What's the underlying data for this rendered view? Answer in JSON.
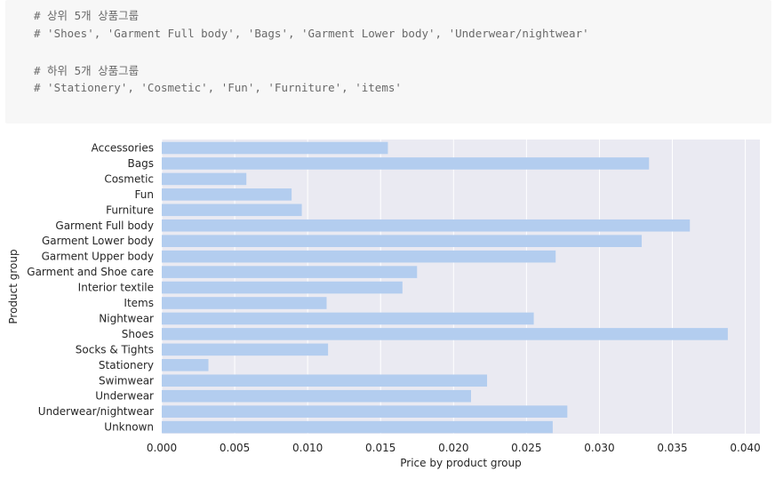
{
  "code_cell": {
    "lines": [
      "# 상위 5개 상품그룹",
      "# 'Shoes', 'Garment Full body', 'Bags', 'Garment Lower body', 'Underwear/nightwear'",
      "",
      "# 하위 5개 상품그룹",
      "# 'Stationery', 'Cosmetic', 'Fun', 'Furniture', 'items'"
    ]
  },
  "chart_data": {
    "type": "bar",
    "orientation": "horizontal",
    "categories": [
      "Accessories",
      "Bags",
      "Cosmetic",
      "Fun",
      "Furniture",
      "Garment Full body",
      "Garment Lower body",
      "Garment Upper body",
      "Garment and Shoe care",
      "Interior textile",
      "Items",
      "Nightwear",
      "Shoes",
      "Socks & Tights",
      "Stationery",
      "Swimwear",
      "Underwear",
      "Underwear/nightwear",
      "Unknown"
    ],
    "values": [
      0.0155,
      0.0334,
      0.0058,
      0.0089,
      0.0096,
      0.0362,
      0.0329,
      0.027,
      0.0175,
      0.0165,
      0.0113,
      0.0255,
      0.0388,
      0.0114,
      0.0032,
      0.0223,
      0.0212,
      0.0278,
      0.0268
    ],
    "xlabel": "Price by product group",
    "ylabel": "Product group",
    "xlim": [
      0,
      0.041
    ],
    "xticks": [
      "0.000",
      "0.005",
      "0.010",
      "0.015",
      "0.020",
      "0.025",
      "0.030",
      "0.035",
      "0.040"
    ],
    "grid": true,
    "bar_color": "#b3cdef",
    "background_color": "#eaeaf2"
  }
}
